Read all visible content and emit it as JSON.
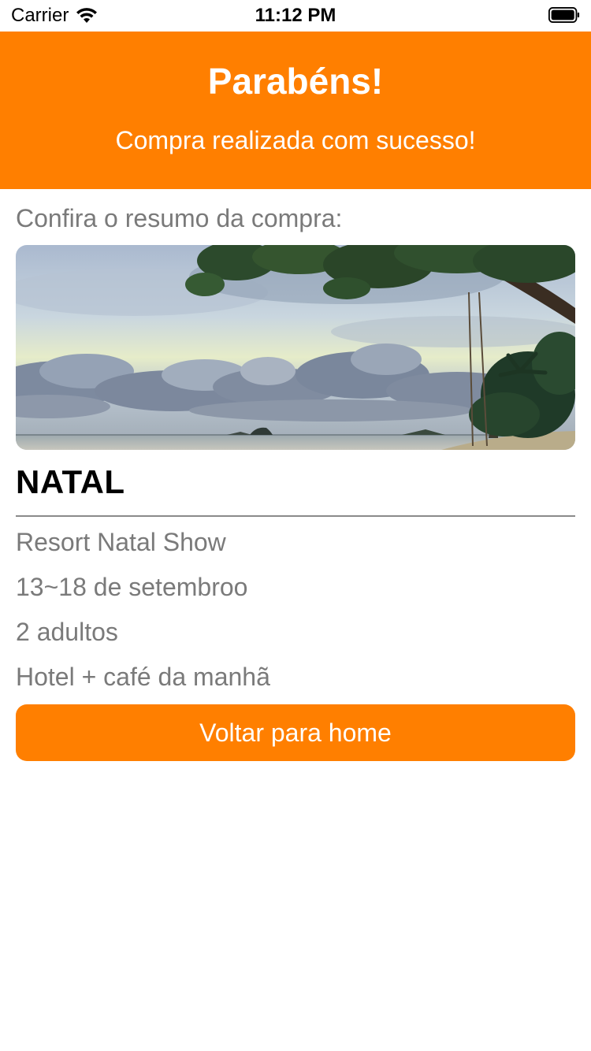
{
  "status_bar": {
    "carrier": "Carrier",
    "time": "11:12 PM",
    "icons": [
      "wifi-icon",
      "battery-icon"
    ]
  },
  "header": {
    "title": "Parabéns!",
    "subtitle": "Compra realizada com sucesso!",
    "background_color": "#ff7f00"
  },
  "summary": {
    "label": "Confira o resumo da compra:",
    "destination": "NATAL",
    "details": [
      "Resort Natal Show",
      "13~18 de setembroo",
      "2 adultos",
      "Hotel + café da manhã"
    ]
  },
  "actions": {
    "home_button_label": "Voltar para home",
    "accent_color": "#ff7f00"
  }
}
